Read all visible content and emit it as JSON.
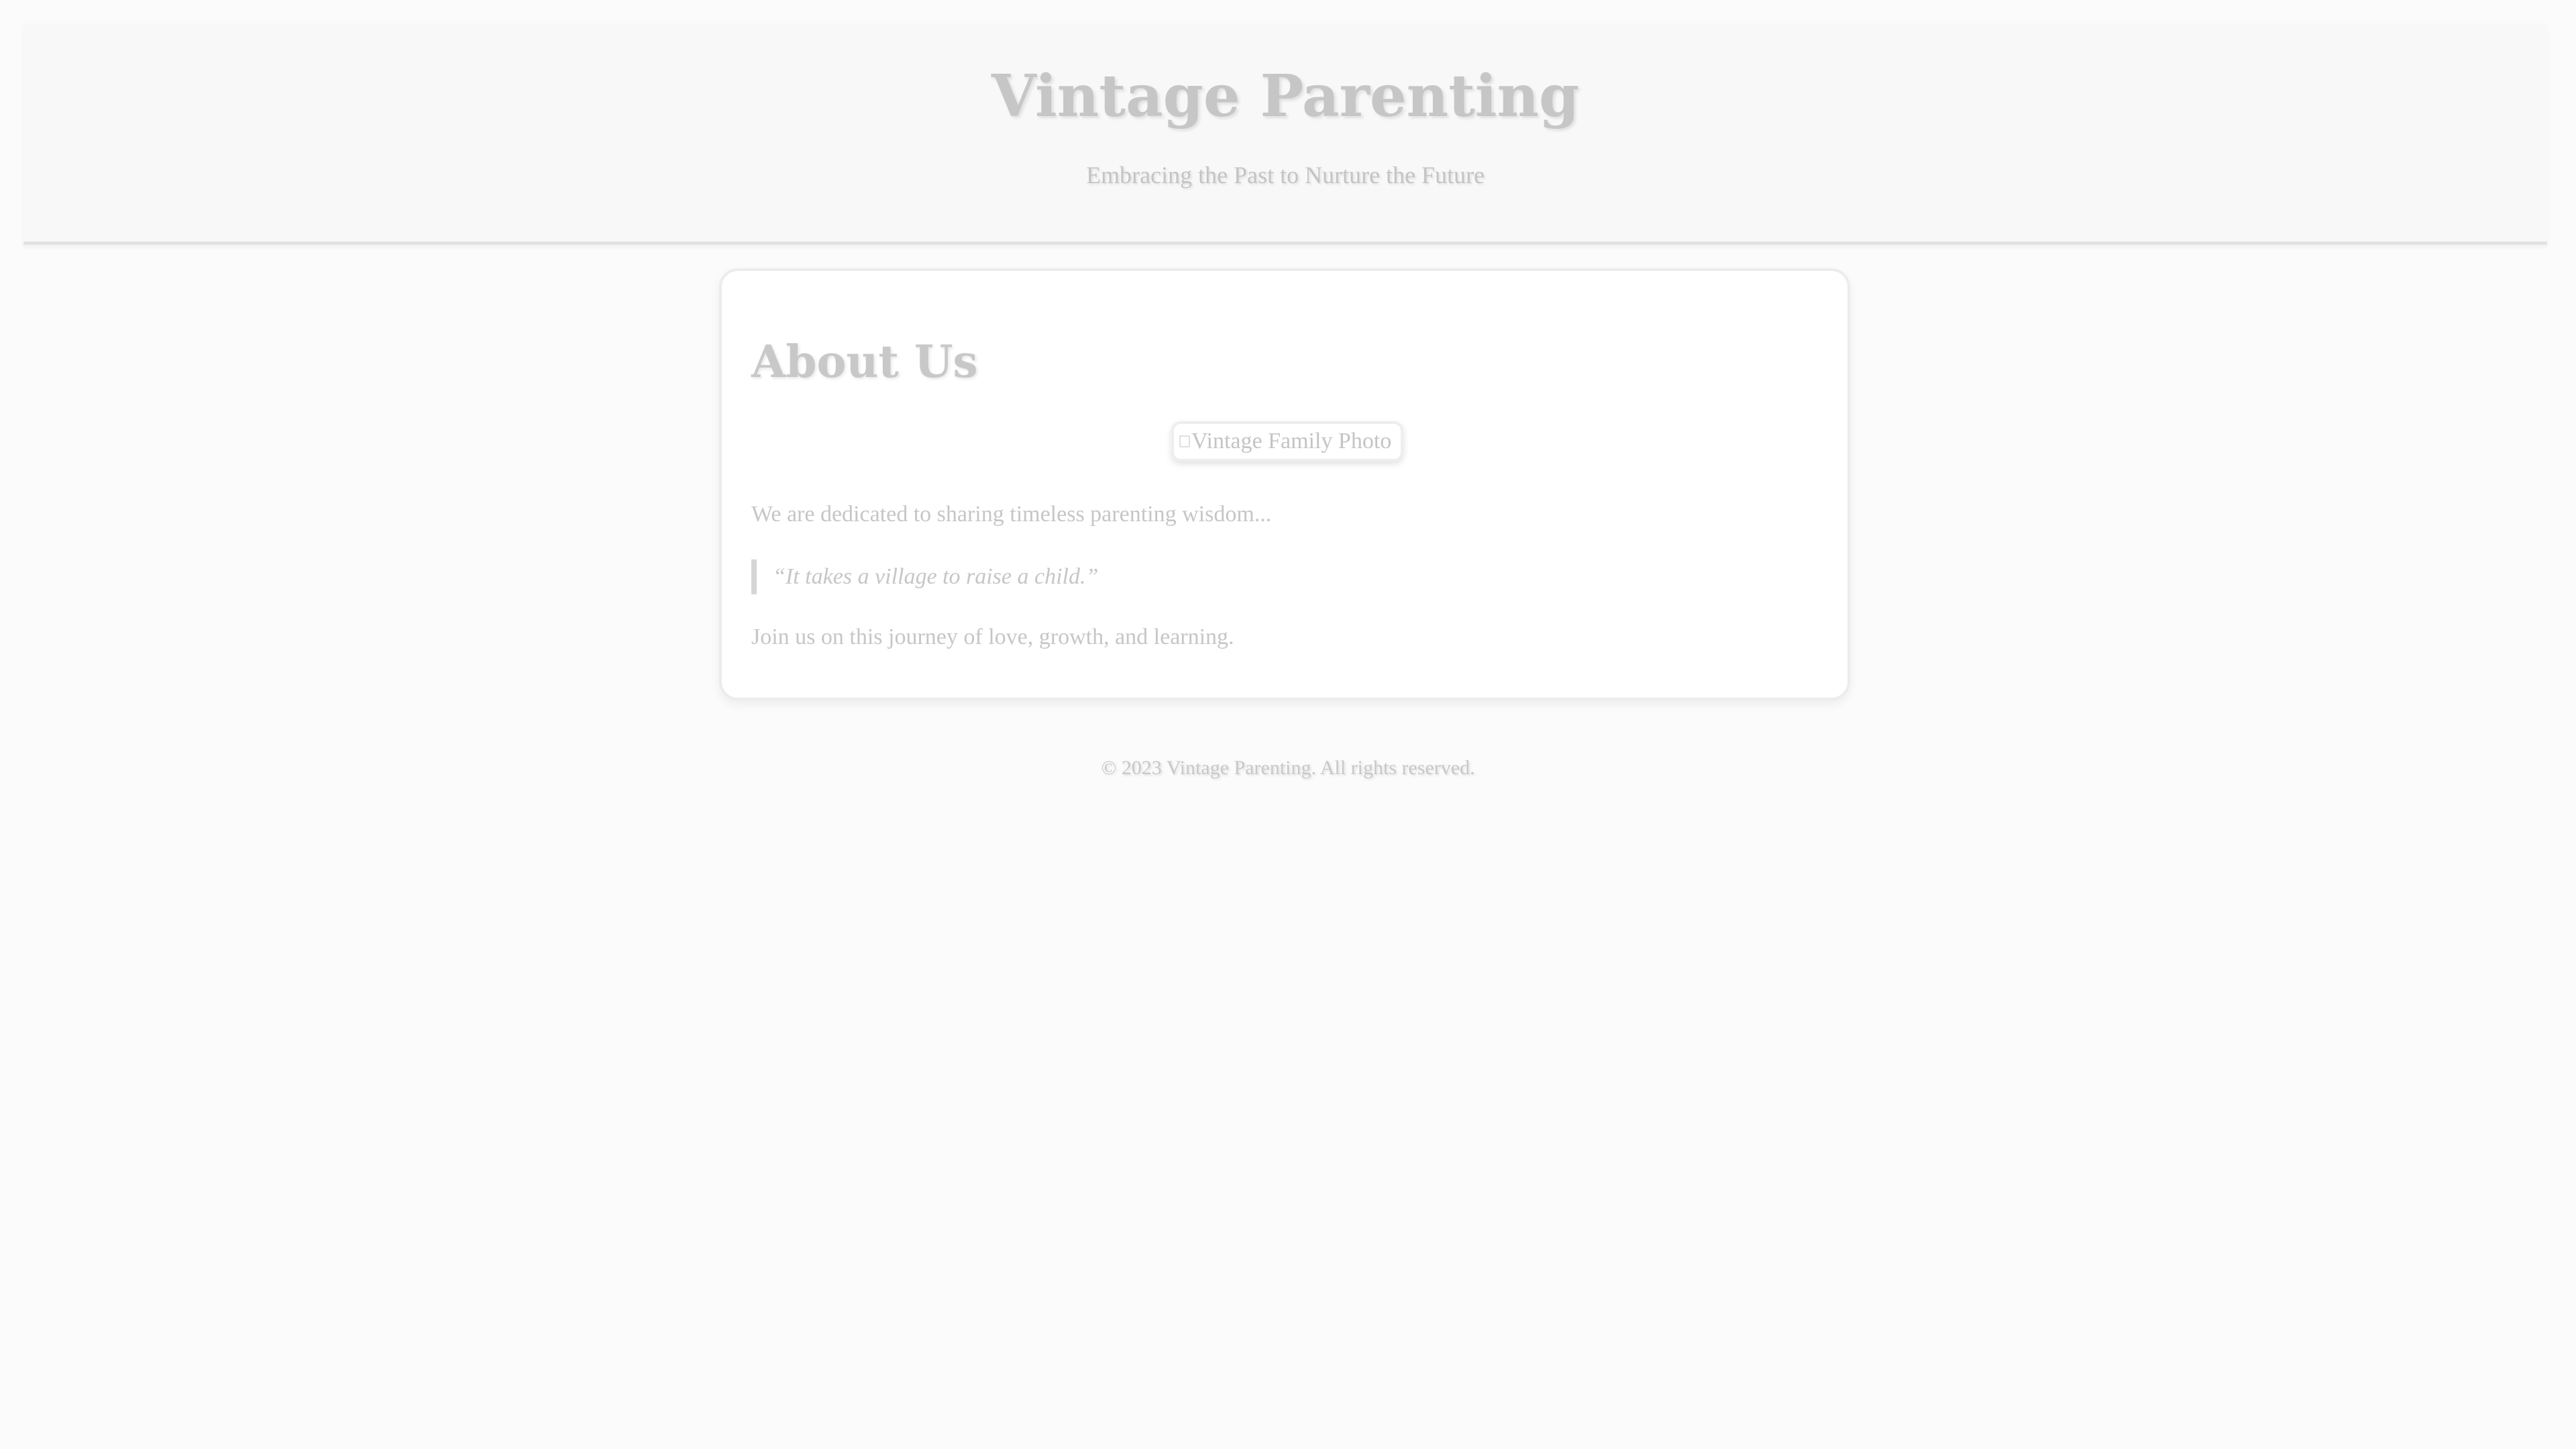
{
  "header": {
    "title": "Vintage Parenting",
    "tagline": "Embracing the Past to Nurture the Future"
  },
  "about": {
    "heading": "About Us",
    "photo_alt": "Vintage Family Photo",
    "intro": "We are dedicated to sharing timeless parenting wisdom...",
    "quote": "“It takes a village to raise a child.”",
    "closing": "Join us on this journey of love, growth, and learning."
  },
  "footer": {
    "copyright": "© 2023 Vintage Parenting. All rights reserved."
  },
  "colors": {
    "background": "#fbfbfb",
    "header_background": "#f8f8f8",
    "card_background": "#ffffff",
    "text": "#c8c8c8",
    "quote_border": "#d6d6d6"
  }
}
